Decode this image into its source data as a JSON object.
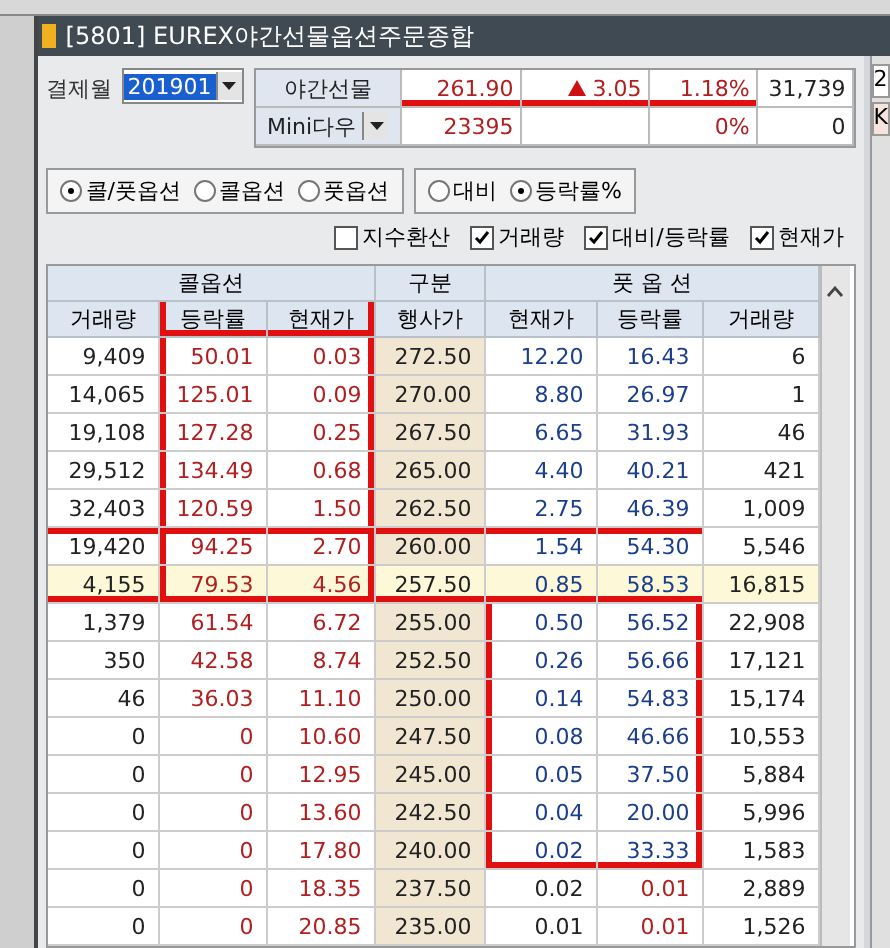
{
  "window": {
    "title": "[5801] EUREX야간선물옵션주문종합"
  },
  "settlement": {
    "label": "결제월",
    "value": "201901"
  },
  "quotes": [
    {
      "name": "야간선물",
      "has_dropdown": false,
      "rising": true,
      "price": "261.90",
      "change": "3.05",
      "rate": "1.18%",
      "volume": "31,739"
    },
    {
      "name": "Mini다우",
      "has_dropdown": true,
      "rising": false,
      "price": "23395",
      "rate": "0%",
      "volume": "0"
    }
  ],
  "option_type": [
    {
      "label": "콜/풋옵션",
      "selected": true
    },
    {
      "label": "콜옵션",
      "selected": false
    },
    {
      "label": "풋옵션",
      "selected": false
    }
  ],
  "display_mode": [
    {
      "label": "대비",
      "selected": false
    },
    {
      "label": "등락률%",
      "selected": true
    }
  ],
  "checkboxes": [
    {
      "label": "지수환산",
      "checked": false
    },
    {
      "label": "거래량",
      "checked": true
    },
    {
      "label": "대비/등락률",
      "checked": true
    },
    {
      "label": "현재가",
      "checked": true
    }
  ],
  "table": {
    "groups": [
      "콜옵션",
      "구분",
      "풋 옵 션"
    ],
    "columns": [
      "거래량",
      "등락률",
      "현재가",
      "행사가",
      "현재가",
      "등락률",
      "거래량"
    ],
    "rows": [
      {
        "c_vol": "9,409",
        "c_rate": "50.01",
        "c_price": "0.03",
        "strike": "272.50",
        "p_price": "12.20",
        "p_rate": "16.43",
        "p_vol": "6",
        "selected": false,
        "p_price_down": true,
        "p_rate_down": true
      },
      {
        "c_vol": "14,065",
        "c_rate": "125.01",
        "c_price": "0.09",
        "strike": "270.00",
        "p_price": "8.80",
        "p_rate": "26.97",
        "p_vol": "1",
        "selected": false,
        "p_price_down": true,
        "p_rate_down": true
      },
      {
        "c_vol": "19,108",
        "c_rate": "127.28",
        "c_price": "0.25",
        "strike": "267.50",
        "p_price": "6.65",
        "p_rate": "31.93",
        "p_vol": "46",
        "selected": false,
        "p_price_down": true,
        "p_rate_down": true
      },
      {
        "c_vol": "29,512",
        "c_rate": "134.49",
        "c_price": "0.68",
        "strike": "265.00",
        "p_price": "4.40",
        "p_rate": "40.21",
        "p_vol": "421",
        "selected": false,
        "p_price_down": true,
        "p_rate_down": true
      },
      {
        "c_vol": "32,403",
        "c_rate": "120.59",
        "c_price": "1.50",
        "strike": "262.50",
        "p_price": "2.75",
        "p_rate": "46.39",
        "p_vol": "1,009",
        "selected": false,
        "p_price_down": true,
        "p_rate_down": true
      },
      {
        "c_vol": "19,420",
        "c_rate": "94.25",
        "c_price": "2.70",
        "strike": "260.00",
        "p_price": "1.54",
        "p_rate": "54.30",
        "p_vol": "5,546",
        "selected": false,
        "p_price_down": true,
        "p_rate_down": true
      },
      {
        "c_vol": "4,155",
        "c_rate": "79.53",
        "c_price": "4.56",
        "strike": "257.50",
        "p_price": "0.85",
        "p_rate": "58.53",
        "p_vol": "16,815",
        "selected": true,
        "p_price_down": true,
        "p_rate_down": true
      },
      {
        "c_vol": "1,379",
        "c_rate": "61.54",
        "c_price": "6.72",
        "strike": "255.00",
        "p_price": "0.50",
        "p_rate": "56.52",
        "p_vol": "22,908",
        "selected": false,
        "p_price_down": true,
        "p_rate_down": true
      },
      {
        "c_vol": "350",
        "c_rate": "42.58",
        "c_price": "8.74",
        "strike": "252.50",
        "p_price": "0.26",
        "p_rate": "56.66",
        "p_vol": "17,121",
        "selected": false,
        "p_price_down": true,
        "p_rate_down": true
      },
      {
        "c_vol": "46",
        "c_rate": "36.03",
        "c_price": "11.10",
        "strike": "250.00",
        "p_price": "0.14",
        "p_rate": "54.83",
        "p_vol": "15,174",
        "selected": false,
        "p_price_down": true,
        "p_rate_down": true
      },
      {
        "c_vol": "0",
        "c_rate": "0",
        "c_price": "10.60",
        "strike": "247.50",
        "p_price": "0.08",
        "p_rate": "46.66",
        "p_vol": "10,553",
        "selected": false,
        "p_price_down": true,
        "p_rate_down": true
      },
      {
        "c_vol": "0",
        "c_rate": "0",
        "c_price": "12.95",
        "strike": "245.00",
        "p_price": "0.05",
        "p_rate": "37.50",
        "p_vol": "5,884",
        "selected": false,
        "p_price_down": true,
        "p_rate_down": true
      },
      {
        "c_vol": "0",
        "c_rate": "0",
        "c_price": "13.60",
        "strike": "242.50",
        "p_price": "0.04",
        "p_rate": "20.00",
        "p_vol": "5,996",
        "selected": false,
        "p_price_down": true,
        "p_rate_down": true
      },
      {
        "c_vol": "0",
        "c_rate": "0",
        "c_price": "17.80",
        "strike": "240.00",
        "p_price": "0.02",
        "p_rate": "33.33",
        "p_vol": "1,583",
        "selected": false,
        "p_price_down": true,
        "p_rate_down": true
      },
      {
        "c_vol": "0",
        "c_rate": "0",
        "c_price": "18.35",
        "strike": "237.50",
        "p_price": "0.02",
        "p_rate": "0.01",
        "p_vol": "2,889",
        "selected": false,
        "p_price_down": false,
        "p_rate_down": false
      },
      {
        "c_vol": "0",
        "c_rate": "0",
        "c_price": "20.85",
        "strike": "235.00",
        "p_price": "0.01",
        "p_rate": "0.01",
        "p_vol": "1,526",
        "selected": false,
        "p_price_down": false,
        "p_rate_down": false
      }
    ]
  },
  "side_panel": {
    "text_1": "2",
    "text_2": "K"
  }
}
